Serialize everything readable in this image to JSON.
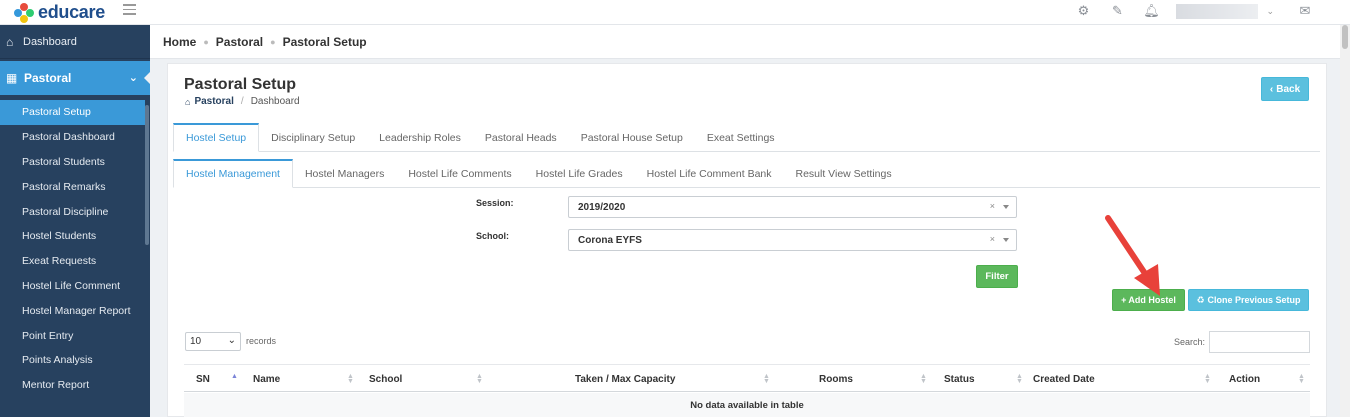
{
  "app": {
    "logo_text": "educare"
  },
  "topbar": {
    "icons": [
      "gear-icon",
      "edit-icon",
      "bell-icon",
      "inbox-icon"
    ]
  },
  "sidebar": {
    "dashboard_label": "Dashboard",
    "section_label": "Pastoral",
    "items": [
      {
        "label": "Pastoral Setup",
        "active": true
      },
      {
        "label": "Pastoral Dashboard"
      },
      {
        "label": "Pastoral Students"
      },
      {
        "label": "Pastoral Remarks"
      },
      {
        "label": "Pastoral Discipline"
      },
      {
        "label": "Hostel Students"
      },
      {
        "label": "Exeat Requests"
      },
      {
        "label": "Hostel Life Comment"
      },
      {
        "label": "Hostel Manager Report"
      },
      {
        "label": "Point Entry"
      },
      {
        "label": "Points Analysis"
      },
      {
        "label": "Mentor Report"
      }
    ]
  },
  "breadcrumb": {
    "items": [
      "Home",
      "Pastoral",
      "Pastoral Setup"
    ]
  },
  "page": {
    "title": "Pastoral Setup",
    "crumb_link": "Pastoral",
    "crumb_current": "Dashboard",
    "back_label": "Back"
  },
  "tabs_primary": [
    "Hostel Setup",
    "Disciplinary Setup",
    "Leadership Roles",
    "Pastoral Heads",
    "Pastoral House Setup",
    "Exeat Settings"
  ],
  "tabs_secondary": [
    "Hostel Management",
    "Hostel Managers",
    "Hostel Life Comments",
    "Hostel Life Grades",
    "Hostel Life Comment Bank",
    "Result View Settings"
  ],
  "filters": {
    "session_label": "Session:",
    "session_value": "2019/2020",
    "school_label": "School:",
    "school_value": "Corona EYFS",
    "clear_glyph": "×",
    "filter_label": "Filter"
  },
  "actions": {
    "add_label": "Add Hostel",
    "clone_label": "Clone Previous Setup"
  },
  "table": {
    "length_value": "10",
    "length_label": "records",
    "search_label": "Search:",
    "columns": [
      "SN",
      "Name",
      "School",
      "Taken / Max Capacity",
      "Rooms",
      "Status",
      "Created Date",
      "Action"
    ],
    "empty_text": "No data available in table"
  },
  "colors": {
    "sidebar": "#27415f",
    "accent": "#3a99d8",
    "success": "#5cb85c",
    "info": "#5bc0de",
    "annotation_arrow": "#e8413a"
  }
}
